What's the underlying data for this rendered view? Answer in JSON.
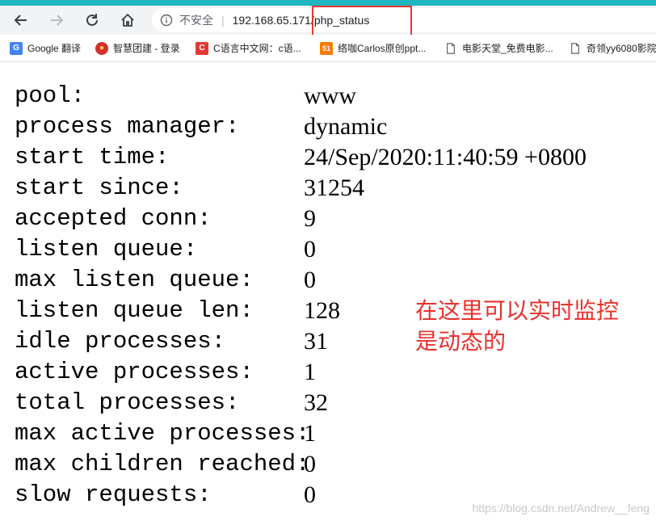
{
  "browser": {
    "accent_color": "#1eb6c0",
    "nav": {
      "back_icon": "arrow-left-icon",
      "forward_icon": "arrow-right-icon",
      "reload_icon": "reload-icon",
      "home_icon": "home-icon"
    },
    "omnibox": {
      "security_label": "不安全",
      "separator": "|",
      "url": "192.168.65.171/php_status"
    },
    "bookmarks": [
      {
        "label": "Google 翻译",
        "icon": "google-translate-icon",
        "icon_text": "G",
        "color": "#4285f4"
      },
      {
        "label": "智慧团建 - 登录",
        "icon": "emblem-icon",
        "icon_text": "●",
        "color": "#d32f2f"
      },
      {
        "label": "C语言中文网：c语...",
        "icon": "c-site-icon",
        "icon_text": "C",
        "color": "#e53935"
      },
      {
        "label": "络咖Carlos原创ppt...",
        "icon": "51-site-icon",
        "icon_text": "51",
        "color": "#f57c00"
      },
      {
        "label": "电影天堂_免费电影...",
        "icon": "page-icon",
        "icon_text": "",
        "color": "#5f6368"
      },
      {
        "label": "奇领yy6080影院",
        "icon": "page-icon",
        "icon_text": "",
        "color": "#5f6368"
      }
    ]
  },
  "status": [
    {
      "key": "pool:",
      "value": "www"
    },
    {
      "key": "process manager:",
      "value": "dynamic"
    },
    {
      "key": "start time:",
      "value": "24/Sep/2020:11:40:59 +0800"
    },
    {
      "key": "start since:",
      "value": "31254"
    },
    {
      "key": "accepted conn:",
      "value": "9"
    },
    {
      "key": "listen queue:",
      "value": "0"
    },
    {
      "key": "max listen queue:",
      "value": "0"
    },
    {
      "key": "listen queue len:",
      "value": "128"
    },
    {
      "key": "idle processes:",
      "value": "31"
    },
    {
      "key": "active processes:",
      "value": "1"
    },
    {
      "key": "total processes:",
      "value": "32"
    },
    {
      "key": "max active processes:",
      "value": "1"
    },
    {
      "key": "max children reached:",
      "value": "0"
    },
    {
      "key": "slow requests:",
      "value": "0"
    }
  ],
  "annotation": {
    "line1": "在这里可以实时监控",
    "line2": "是动态的",
    "color": "#e8322c"
  },
  "watermark": "https://blog.csdn.net/Andrew__feng"
}
